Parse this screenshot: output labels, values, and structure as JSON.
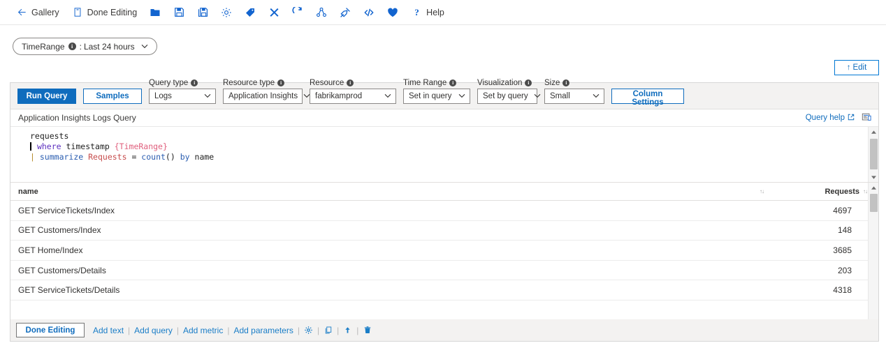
{
  "command_bar": {
    "items": [
      {
        "id": "gallery",
        "icon": "back-arrow-icon",
        "label": "Gallery"
      },
      {
        "id": "done-editing",
        "icon": "edit-page-icon",
        "label": "Done Editing"
      },
      {
        "id": "open",
        "icon": "folder-icon",
        "label": ""
      },
      {
        "id": "save",
        "icon": "save-icon",
        "label": ""
      },
      {
        "id": "save-as",
        "icon": "save-as-icon",
        "label": ""
      },
      {
        "id": "settings",
        "icon": "gear-icon",
        "label": ""
      },
      {
        "id": "tag",
        "icon": "tag-icon",
        "label": ""
      },
      {
        "id": "close",
        "icon": "close-icon",
        "label": ""
      },
      {
        "id": "refresh",
        "icon": "refresh-icon",
        "label": ""
      },
      {
        "id": "share",
        "icon": "share-icon",
        "label": ""
      },
      {
        "id": "pin",
        "icon": "pin-icon",
        "label": ""
      },
      {
        "id": "code",
        "icon": "code-icon",
        "label": ""
      },
      {
        "id": "favorite",
        "icon": "heart-icon",
        "label": ""
      },
      {
        "id": "help",
        "icon": "question-icon",
        "label": "Help"
      }
    ]
  },
  "parameters": {
    "time_range_pill": {
      "name": "TimeRange",
      "separator": ":",
      "value": "Last 24 hours",
      "chevron": "⌄"
    }
  },
  "edit_button": {
    "arrow": "↑",
    "label": "Edit"
  },
  "query_toolbar": {
    "run_query_label": "Run Query",
    "samples_label": "Samples",
    "column_settings_label": "Column Settings",
    "fields": [
      {
        "id": "query-type",
        "label": "Query type",
        "value": "Logs",
        "width": "w-querytype"
      },
      {
        "id": "resource-type",
        "label": "Resource type",
        "value": "Application Insights",
        "width": "w-restype"
      },
      {
        "id": "resource",
        "label": "Resource",
        "value": "fabrikamprod",
        "width": "w-resource"
      },
      {
        "id": "time-range",
        "label": "Time Range",
        "value": "Set in query",
        "width": "w-timerange"
      },
      {
        "id": "visualization",
        "label": "Visualization",
        "value": "Set by query",
        "width": "w-viz"
      },
      {
        "id": "size",
        "label": "Size",
        "value": "Small",
        "width": "w-size"
      }
    ]
  },
  "query_header": {
    "title": "Application Insights Logs Query",
    "query_help_label": "Query help",
    "external_link_glyph": "⧉"
  },
  "code_editor": {
    "language": "kql",
    "lines": [
      {
        "indent": 1,
        "selected": false,
        "caret": false,
        "tokens": [
          {
            "text": "requests",
            "type": "ident"
          }
        ]
      },
      {
        "indent": 0,
        "selected": true,
        "caret": true,
        "tokens": [
          {
            "text": " ",
            "type": "plain"
          },
          {
            "text": "where",
            "type": "kw2"
          },
          {
            "text": " ",
            "type": "plain"
          },
          {
            "text": "timestamp",
            "type": "ident"
          },
          {
            "text": " ",
            "type": "plain"
          },
          {
            "text": "{TimeRange}",
            "type": "param"
          }
        ]
      },
      {
        "indent": 0,
        "selected": false,
        "caret": false,
        "tokens": [
          {
            "text": "|",
            "type": "pipe"
          },
          {
            "text": " ",
            "type": "plain"
          },
          {
            "text": "summarize",
            "type": "kw"
          },
          {
            "text": " ",
            "type": "plain"
          },
          {
            "text": "Requests",
            "type": "col"
          },
          {
            "text": " = ",
            "type": "plain"
          },
          {
            "text": "count",
            "type": "func"
          },
          {
            "text": "()",
            "type": "plain"
          },
          {
            "text": " ",
            "type": "plain"
          },
          {
            "text": "by",
            "type": "kw"
          },
          {
            "text": " ",
            "type": "plain"
          },
          {
            "text": "name",
            "type": "ident"
          }
        ]
      }
    ],
    "raw": "requests\n| where timestamp {TimeRange}\n| summarize Requests = count() by name"
  },
  "results_grid": {
    "columns": [
      {
        "id": "name",
        "label": "name",
        "align": "left",
        "sortable": true
      },
      {
        "id": "requests",
        "label": "Requests",
        "align": "right",
        "sortable": true
      }
    ],
    "sort_glyph": "↑↓",
    "rows": [
      {
        "name": "GET ServiceTickets/Index",
        "requests": "4697"
      },
      {
        "name": "GET Customers/Index",
        "requests": "148"
      },
      {
        "name": "GET Home/Index",
        "requests": "3685"
      },
      {
        "name": "GET Customers/Details",
        "requests": "203"
      },
      {
        "name": "GET ServiceTickets/Details",
        "requests": "4318"
      }
    ]
  },
  "bottom_bar": {
    "done_editing_label": "Done Editing",
    "links": [
      {
        "id": "add-text",
        "label": "Add text"
      },
      {
        "id": "add-query",
        "label": "Add query"
      },
      {
        "id": "add-metric",
        "label": "Add metric"
      },
      {
        "id": "add-parameters",
        "label": "Add parameters"
      }
    ],
    "separator": "|",
    "icons": [
      {
        "id": "settings",
        "icon": "gear-icon"
      },
      {
        "id": "clone",
        "icon": "copy-icon"
      },
      {
        "id": "move-up",
        "icon": "arrow-up-icon"
      },
      {
        "id": "delete",
        "icon": "trash-icon"
      }
    ]
  },
  "colors": {
    "accent": "#0f6cbd",
    "link": "#1a7dc7",
    "toolbar_bg": "#f3f2f1",
    "border": "#d6d6d6",
    "selection": "#cfe5fb",
    "kql_keyword": "#2a5db0",
    "kql_param": "#e0607e",
    "kql_column": "#c74d4d"
  }
}
